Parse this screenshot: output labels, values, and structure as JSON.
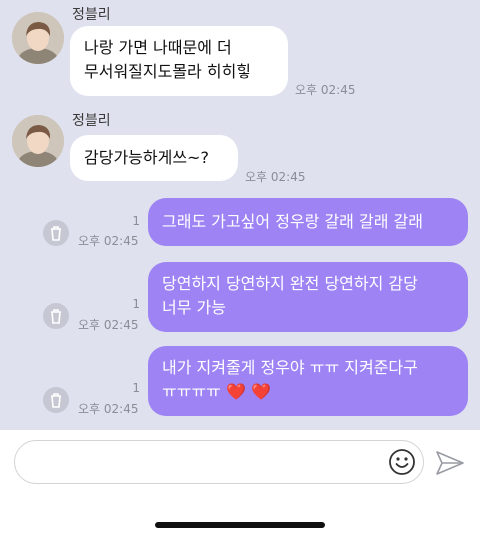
{
  "messages": [
    {
      "sender": "정블리",
      "text": "나랑 가면 나때문에 더\n무서워질지도몰라 히히힣",
      "time": "오후 02:45"
    },
    {
      "sender": "정블리",
      "text": "감당가능하게쓰~?",
      "time": "오후 02:45"
    },
    {
      "text": "그래도 가고싶어 정우랑 갈래 갈래 갈래",
      "unread": "1",
      "time": "오후 02:45"
    },
    {
      "text": "당연하지 당연하지 완전 당연하지 감당\n너무 가능",
      "unread": "1",
      "time": "오후 02:45"
    },
    {
      "text": "내가 지켜줄게 정우야 ㅠㅠ 지켜준다구\nㅠㅠㅠㅠ ❤️ ❤️",
      "unread": "1",
      "time": "오후 02:45"
    }
  ],
  "composer": {
    "placeholder": ""
  },
  "colors": {
    "background": "#dfe2ee",
    "outgoing_bubble": "#9d83f4",
    "incoming_bubble": "#ffffff"
  }
}
